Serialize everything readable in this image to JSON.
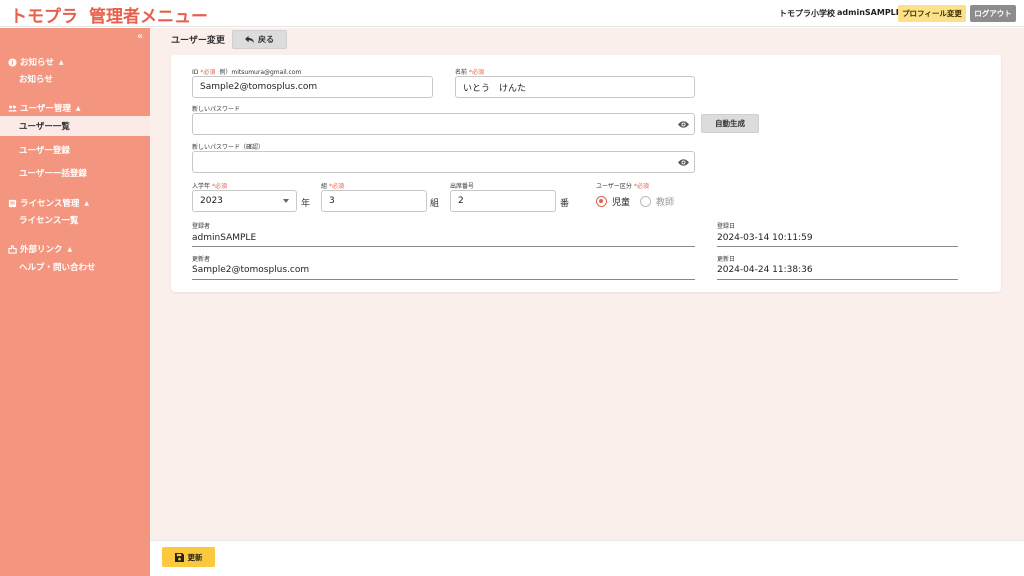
{
  "header": {
    "brand": "トモプラ",
    "title": "管理者メニュー",
    "school": "トモプラ小学校",
    "user": "adminSAMPLE",
    "profile_button": "プロフィール変更",
    "logout_button": "ログアウト"
  },
  "sidebar": {
    "collapse_glyph": "«",
    "sections": [
      {
        "label": "お知らせ",
        "icon": "info-icon",
        "items": [
          "お知らせ"
        ]
      },
      {
        "label": "ユーザー管理",
        "icon": "users-icon",
        "items": [
          "ユーザー一覧",
          "ユーザー登録",
          "ユーザー一括登録"
        ]
      },
      {
        "label": "ライセンス管理",
        "icon": "license-icon",
        "items": [
          "ライセンス一覧"
        ]
      },
      {
        "label": "外部リンク",
        "icon": "external-link-icon",
        "items": [
          "ヘルプ・問い合わせ"
        ]
      }
    ],
    "active_item": "ユーザー一覧"
  },
  "main": {
    "page_title": "ユーザー変更",
    "back_button": "戻る"
  },
  "form": {
    "id": {
      "label": "ID",
      "required": "*必須",
      "example": "例）mitsumura@gmail.com",
      "value": "Sample2@tomosplus.com"
    },
    "name": {
      "label": "名前",
      "required": "*必須",
      "value": "いとう　けんた"
    },
    "new_password": {
      "label": "新しいパスワード",
      "value": ""
    },
    "auto_generate_button": "自動生成",
    "confirm_password": {
      "label": "新しいパスワード（確認）",
      "value": ""
    },
    "enroll_year": {
      "label": "入学年",
      "required": "*必須",
      "value": "2023",
      "unit": "年"
    },
    "class_group": {
      "label": "組",
      "required": "*必須",
      "value": "3",
      "unit": "組"
    },
    "seat_number": {
      "label": "出席番号",
      "value": "2",
      "unit": "番"
    },
    "user_type": {
      "label": "ユーザー区分",
      "required": "*必須",
      "options": [
        "児童",
        "教師"
      ],
      "selected": "児童"
    },
    "registered_by": {
      "label": "登録者",
      "value": "adminSAMPLE"
    },
    "registered_at": {
      "label": "登録日",
      "value": "2024-03-14 10:11:59"
    },
    "updated_by": {
      "label": "更新者",
      "value": "Sample2@tomosplus.com"
    },
    "updated_at": {
      "label": "更新日",
      "value": "2024-04-24 11:38:36"
    }
  },
  "footer": {
    "save_button": "更新"
  },
  "colors": {
    "accent": "#e8604c",
    "sidebar": "#f4967f",
    "main_bg": "#fbefec",
    "save": "#fcc93e",
    "profile": "#fce18a"
  }
}
